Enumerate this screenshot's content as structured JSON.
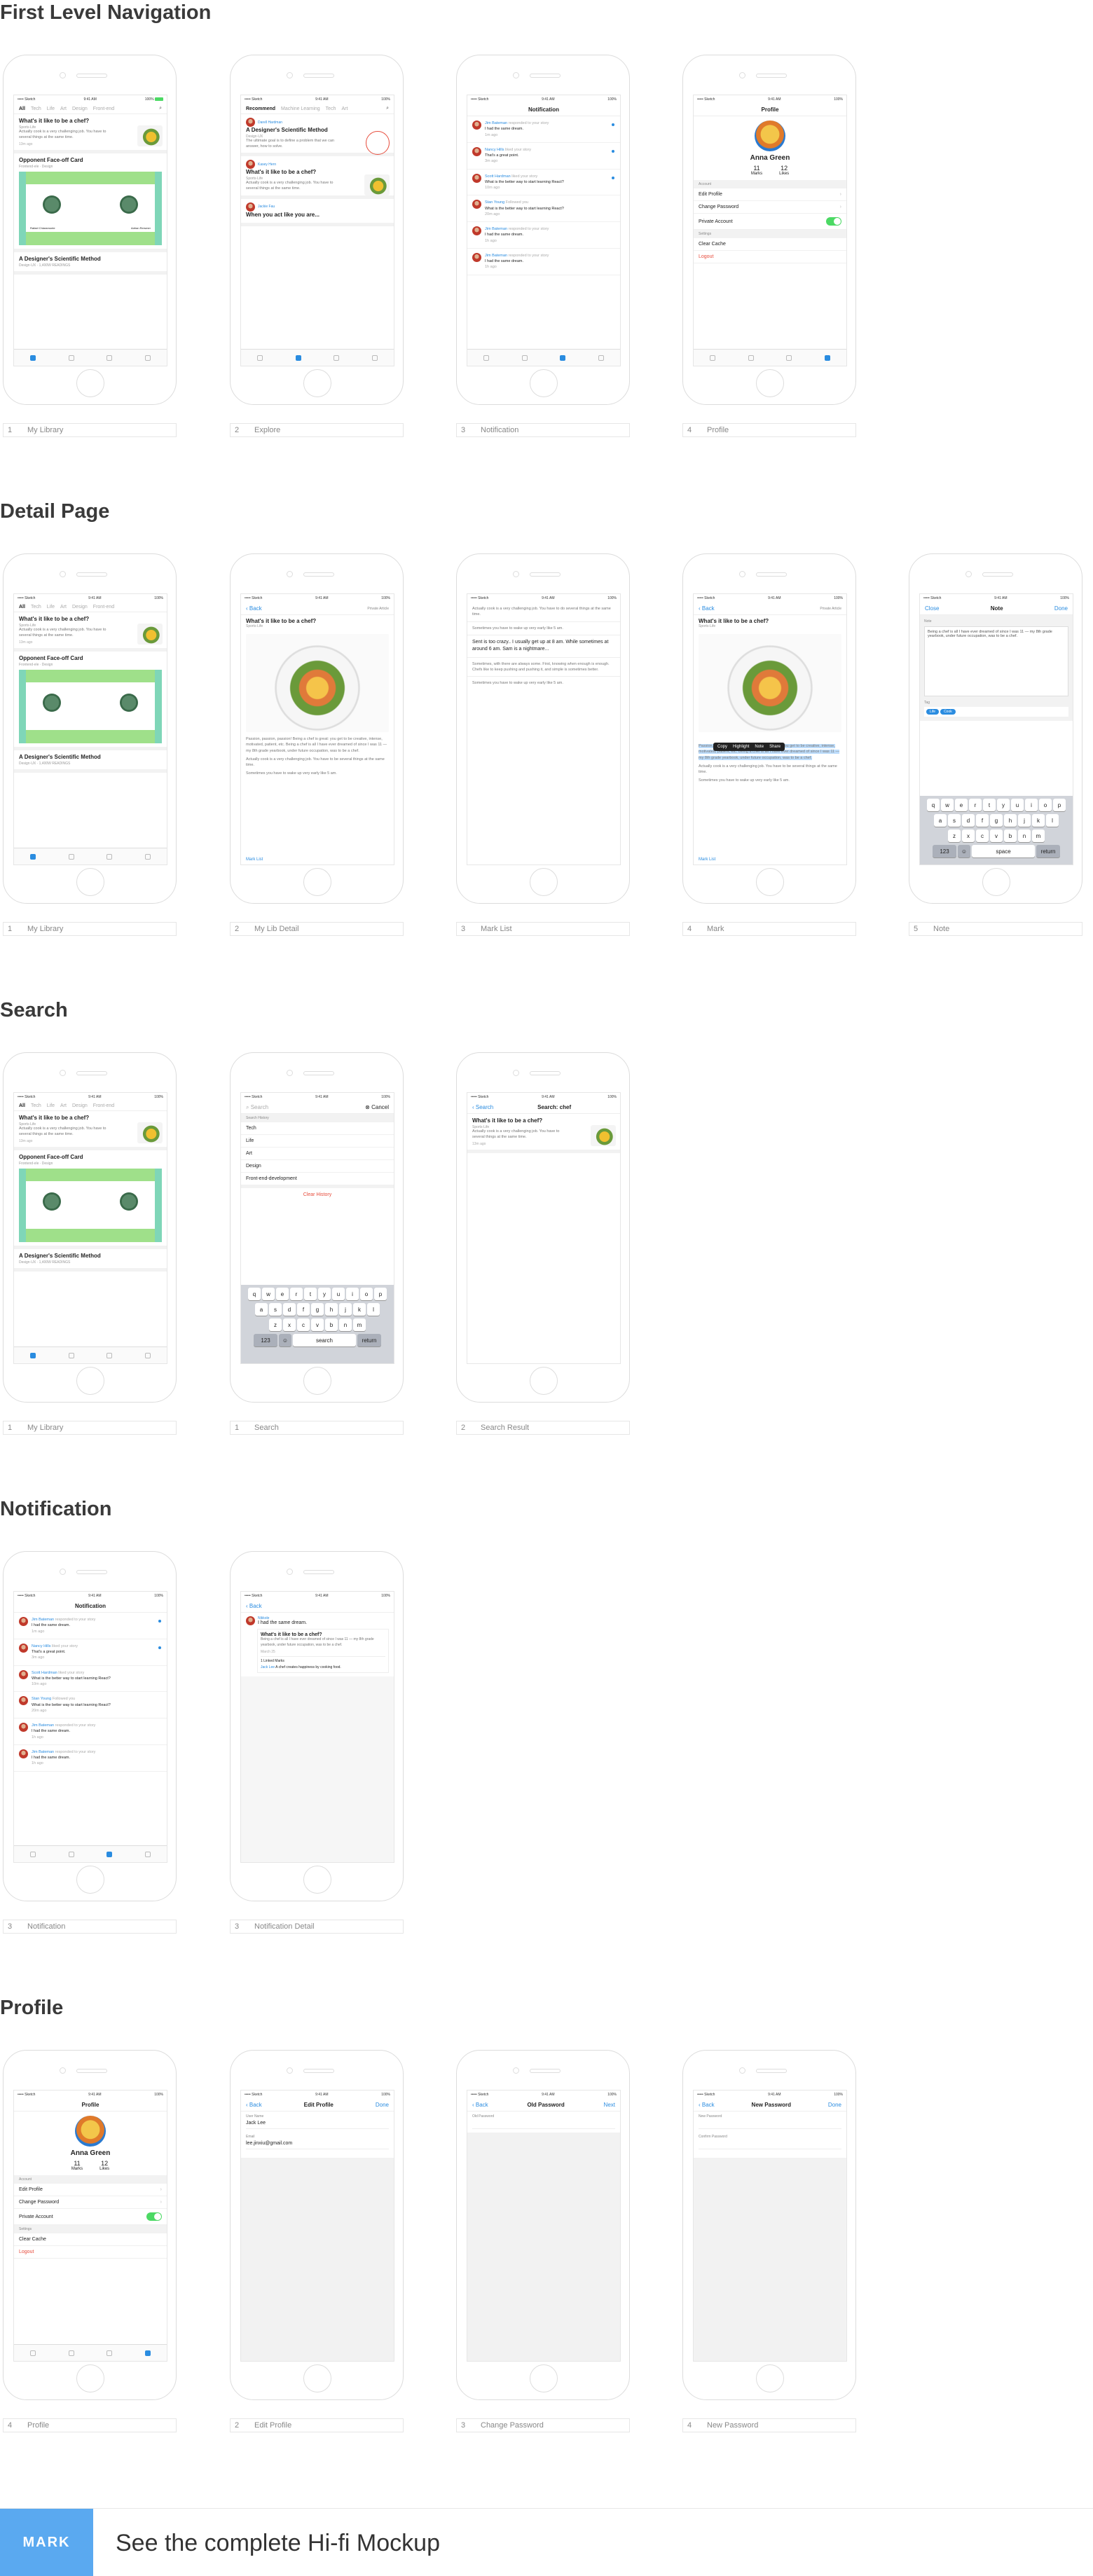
{
  "sections": {
    "first": "First Level Navigation",
    "detail": "Detail Page",
    "search": "Search",
    "notification": "Notification",
    "profile": "Profile"
  },
  "status": {
    "carrier": "••••• Sketch",
    "time": "9:41 AM",
    "battery": "100%"
  },
  "home": {
    "tabs": [
      "All",
      "Tech",
      "Life",
      "Art",
      "Design",
      "Front-end"
    ],
    "card1": {
      "title": "What's it like to be a chef?",
      "meta": "Sports·Life",
      "text": "Actually cook is a very challenging job. You have to several things at the same time.",
      "time": "13m ago",
      "likes": "23",
      "comments": "15"
    },
    "card2": {
      "title": "Opponent Face-off Card",
      "meta": "Frontend·ele · Design",
      "left": "Rafael Chiaramonte",
      "right": "Adrian Rersmer"
    },
    "card3": {
      "title": "A Designer's Scientific Method",
      "meta": "Design·UX · 1,400W READINGS"
    }
  },
  "explore": {
    "tabs": [
      "Recommend",
      "Machine Learning",
      "Tech",
      "Art"
    ],
    "user1": "Darell Hardman",
    "title1": "A Designer's Scientific Method",
    "meta1": "Design·UX",
    "text1": "The ultimate goal is to define a problem that we can answer, how to solve.",
    "user2": "Kasey Hern",
    "title2": "What's it like to be a chef?",
    "meta2": "Sports·Life",
    "text2": "Actually cook is a very challenging job. You have to several things at the same time.",
    "user3": "Jackie Fau",
    "title3": "When you act like you are..."
  },
  "notif": {
    "title": "Notification",
    "items": [
      {
        "user": "Jim Bateman",
        "act": "responded to your story",
        "text": "I had the same dream.",
        "time": "1m ago"
      },
      {
        "user": "Nancy Hills",
        "act": "liked your story",
        "text": "That's a great point.",
        "time": "3m ago"
      },
      {
        "user": "Scott Hardman",
        "act": "liked your story",
        "text": "What is the better way to start learning React?",
        "time": "10m ago"
      },
      {
        "user": "Stan Young",
        "act": "Followed you",
        "text": "What is the better way to start learning React?",
        "time": "20m ago"
      },
      {
        "user": "Jim Bateman",
        "act": "responded to your story",
        "text": "I had the same dream.",
        "time": "1h ago"
      },
      {
        "user": "Jim Bateman",
        "act": "responded to your story",
        "text": "I had the same dream.",
        "time": "1h ago"
      }
    ]
  },
  "profile": {
    "title": "Profile",
    "name": "Anna Green",
    "marks": "11",
    "marks_lbl": "Marks",
    "likes": "12",
    "likes_lbl": "Likes",
    "account": "Account",
    "edit": "Edit Profile",
    "change": "Change Password",
    "private": "Private Account",
    "settings": "Settings",
    "cache": "Clear Cache",
    "logout": "Logout"
  },
  "detail": {
    "back": "Back",
    "private": "Private Article",
    "title": "What's it like to be a chef?",
    "meta": "Sports·Life",
    "p1": "Passion, passion, passion! Being a chef is great: you get to be creative, intense, motivated, patient, etc. Being a chef is all I have ever dreamed of since I was 11 — my 8th grade yearbook, under future occupation, was to be a chef.",
    "p2": "Actually cook is a very challenging job. You have to be several things at the same time.",
    "p3": "Sometimes you have to wake up very early like 5 am.",
    "marklist": "Mark List"
  },
  "marklist": {
    "a": "Actually cook is a very challenging job. You have to do several things at the same time.",
    "b": "Sometimes you have to wake up very early like 5 am.",
    "c": "Sent is too crazy.. I usually get up at 8 am. While sometimes at around 6 am. Sam is a nightmare...",
    "d": "Sometimes, with there are always some. First, knowing when enough is enough. Chefs like to keep pushing and pushing it, and simple is sometimes better.",
    "e": "Sometimes you have to wake up very early like 5 am."
  },
  "mark": {
    "menu": [
      "Copy",
      "Highlight",
      "Note",
      "Share"
    ]
  },
  "note": {
    "close": "Close",
    "title": "Note",
    "done": "Done",
    "lbl": "Note",
    "text": "Being a chef is all I have ever dreamed of since I was 11 — my 8th grade yearbook, under future occupation, was to be a chef.",
    "tags_lbl": "Tag",
    "tags": [
      "Life",
      "Cook"
    ]
  },
  "search": {
    "placeholder": "Search",
    "cancel": "Cancel",
    "history": "Search History",
    "items": [
      "Tech",
      "Life",
      "Art",
      "Design",
      "Front-end-development"
    ],
    "clear": "Clear History",
    "space": "space",
    "search_key": "search",
    "return": "return",
    "k123": "123",
    "result_title": "Search: chef"
  },
  "keys": {
    "r1": [
      "q",
      "w",
      "e",
      "r",
      "t",
      "y",
      "u",
      "i",
      "o",
      "p"
    ],
    "r2": [
      "a",
      "s",
      "d",
      "f",
      "g",
      "h",
      "j",
      "k",
      "l"
    ],
    "r3": [
      "z",
      "x",
      "c",
      "v",
      "b",
      "n",
      "m"
    ]
  },
  "ndetail": {
    "user": "Nikkole",
    "said": "I had the same dream.",
    "title": "What's it like to be a chef?",
    "text": "Being a chef is all I have ever dreamed of since I was 11 — my 8th grade yearbook, under future occupation, was to be a chef.",
    "time": "March 25",
    "linked": "1 Linked Marks",
    "quote_user": "Jack Lee",
    "quote": "A chef creates happiness by cooking food."
  },
  "edit": {
    "back": "Back",
    "title": "Edit Profile",
    "done": "Done",
    "name_lbl": "User Name",
    "name": "Jack Lee",
    "email_lbl": "Email",
    "email": "lee.jinxiu@gmail.com"
  },
  "oldpw": {
    "back": "Back",
    "title": "Old Password",
    "next": "Next",
    "lbl": "Old Password"
  },
  "newpw": {
    "back": "Back",
    "title": "New Password",
    "done": "Done",
    "lbl1": "New Password",
    "lbl2": "Confirm Password"
  },
  "captions": {
    "s1": [
      [
        "1",
        "My Library"
      ],
      [
        "2",
        "Explore"
      ],
      [
        "3",
        "Notification"
      ],
      [
        "4",
        "Profile"
      ]
    ],
    "s2": [
      [
        "1",
        "My Library"
      ],
      [
        "2",
        "My Lib Detail"
      ],
      [
        "3",
        "Mark List"
      ],
      [
        "4",
        "Mark"
      ],
      [
        "5",
        "Note"
      ]
    ],
    "s3": [
      [
        "1",
        "My Library"
      ],
      [
        "1",
        "Search"
      ],
      [
        "2",
        "Search Result"
      ]
    ],
    "s4": [
      [
        "3",
        "Notification"
      ],
      [
        "3",
        "Notification Detail"
      ]
    ],
    "s5": [
      [
        "4",
        "Profile"
      ],
      [
        "2",
        "Edit Profile"
      ],
      [
        "3",
        "Change Password"
      ],
      [
        "4",
        "New Password"
      ]
    ]
  },
  "banner": {
    "logo": "MARK",
    "text": "See the complete Hi-fi Mockup"
  }
}
